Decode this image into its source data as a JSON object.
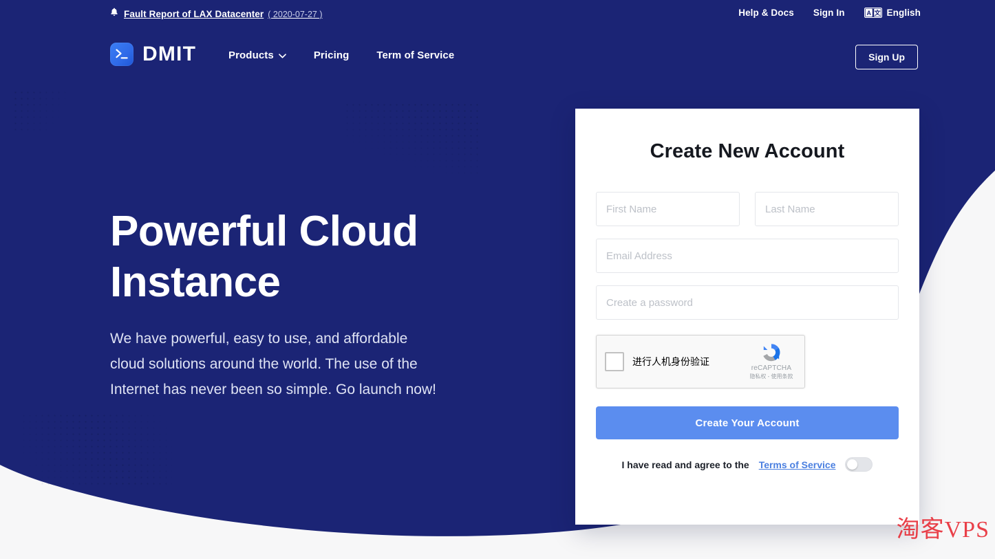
{
  "colors": {
    "hero_blue": "#1b2475",
    "page_bg": "#f7f7f8",
    "accent_blue": "#5b8def",
    "link_blue": "#4a7fe0",
    "watermark_red": "#e8303a"
  },
  "topbar": {
    "notice_icon": "bell-icon",
    "notice_title": "Fault Report of LAX Datacenter",
    "notice_date": "( 2020-07-27 )",
    "links": [
      {
        "label": "Help & Docs",
        "name": "help-and-docs-link"
      },
      {
        "label": "Sign In",
        "name": "sign-in-link"
      }
    ],
    "language": {
      "icon": "translate-icon",
      "icon_left_glyph": "A",
      "icon_right_glyph": "文",
      "label": "English"
    }
  },
  "nav": {
    "brand": {
      "icon": "terminal-logo-icon",
      "name": "DMIT"
    },
    "links": [
      {
        "label": "Products",
        "name": "nav-products",
        "has_caret": true
      },
      {
        "label": "Pricing",
        "name": "nav-pricing",
        "has_caret": false
      },
      {
        "label": "Term of Service",
        "name": "nav-term-of-service",
        "has_caret": false
      }
    ],
    "caret_icon": "chevron-down-icon",
    "signup_label": "Sign Up"
  },
  "hero": {
    "heading": "Powerful Cloud Instance",
    "paragraph": "We have powerful, easy to use, and affordable cloud solutions around the world. The use of the Internet has never been so simple. Go launch now!"
  },
  "signup_card": {
    "title": "Create New Account",
    "fields": {
      "first_name": {
        "placeholder": "First Name",
        "value": ""
      },
      "last_name": {
        "placeholder": "Last Name",
        "value": ""
      },
      "email": {
        "placeholder": "Email Address",
        "value": ""
      },
      "password": {
        "placeholder": "Create a password",
        "value": ""
      }
    },
    "recaptcha": {
      "checkbox_checked": false,
      "label": "进行人机身份验证",
      "brand": "reCAPTCHA",
      "legal": "隐私权 - 使用条款",
      "logo_icon": "recaptcha-logo-icon"
    },
    "submit_label": "Create Your Account",
    "terms": {
      "text": "I have read and agree to the",
      "link_label": "Terms of Service",
      "toggle_on": false
    }
  },
  "watermark": {
    "text": "淘客VPS"
  }
}
